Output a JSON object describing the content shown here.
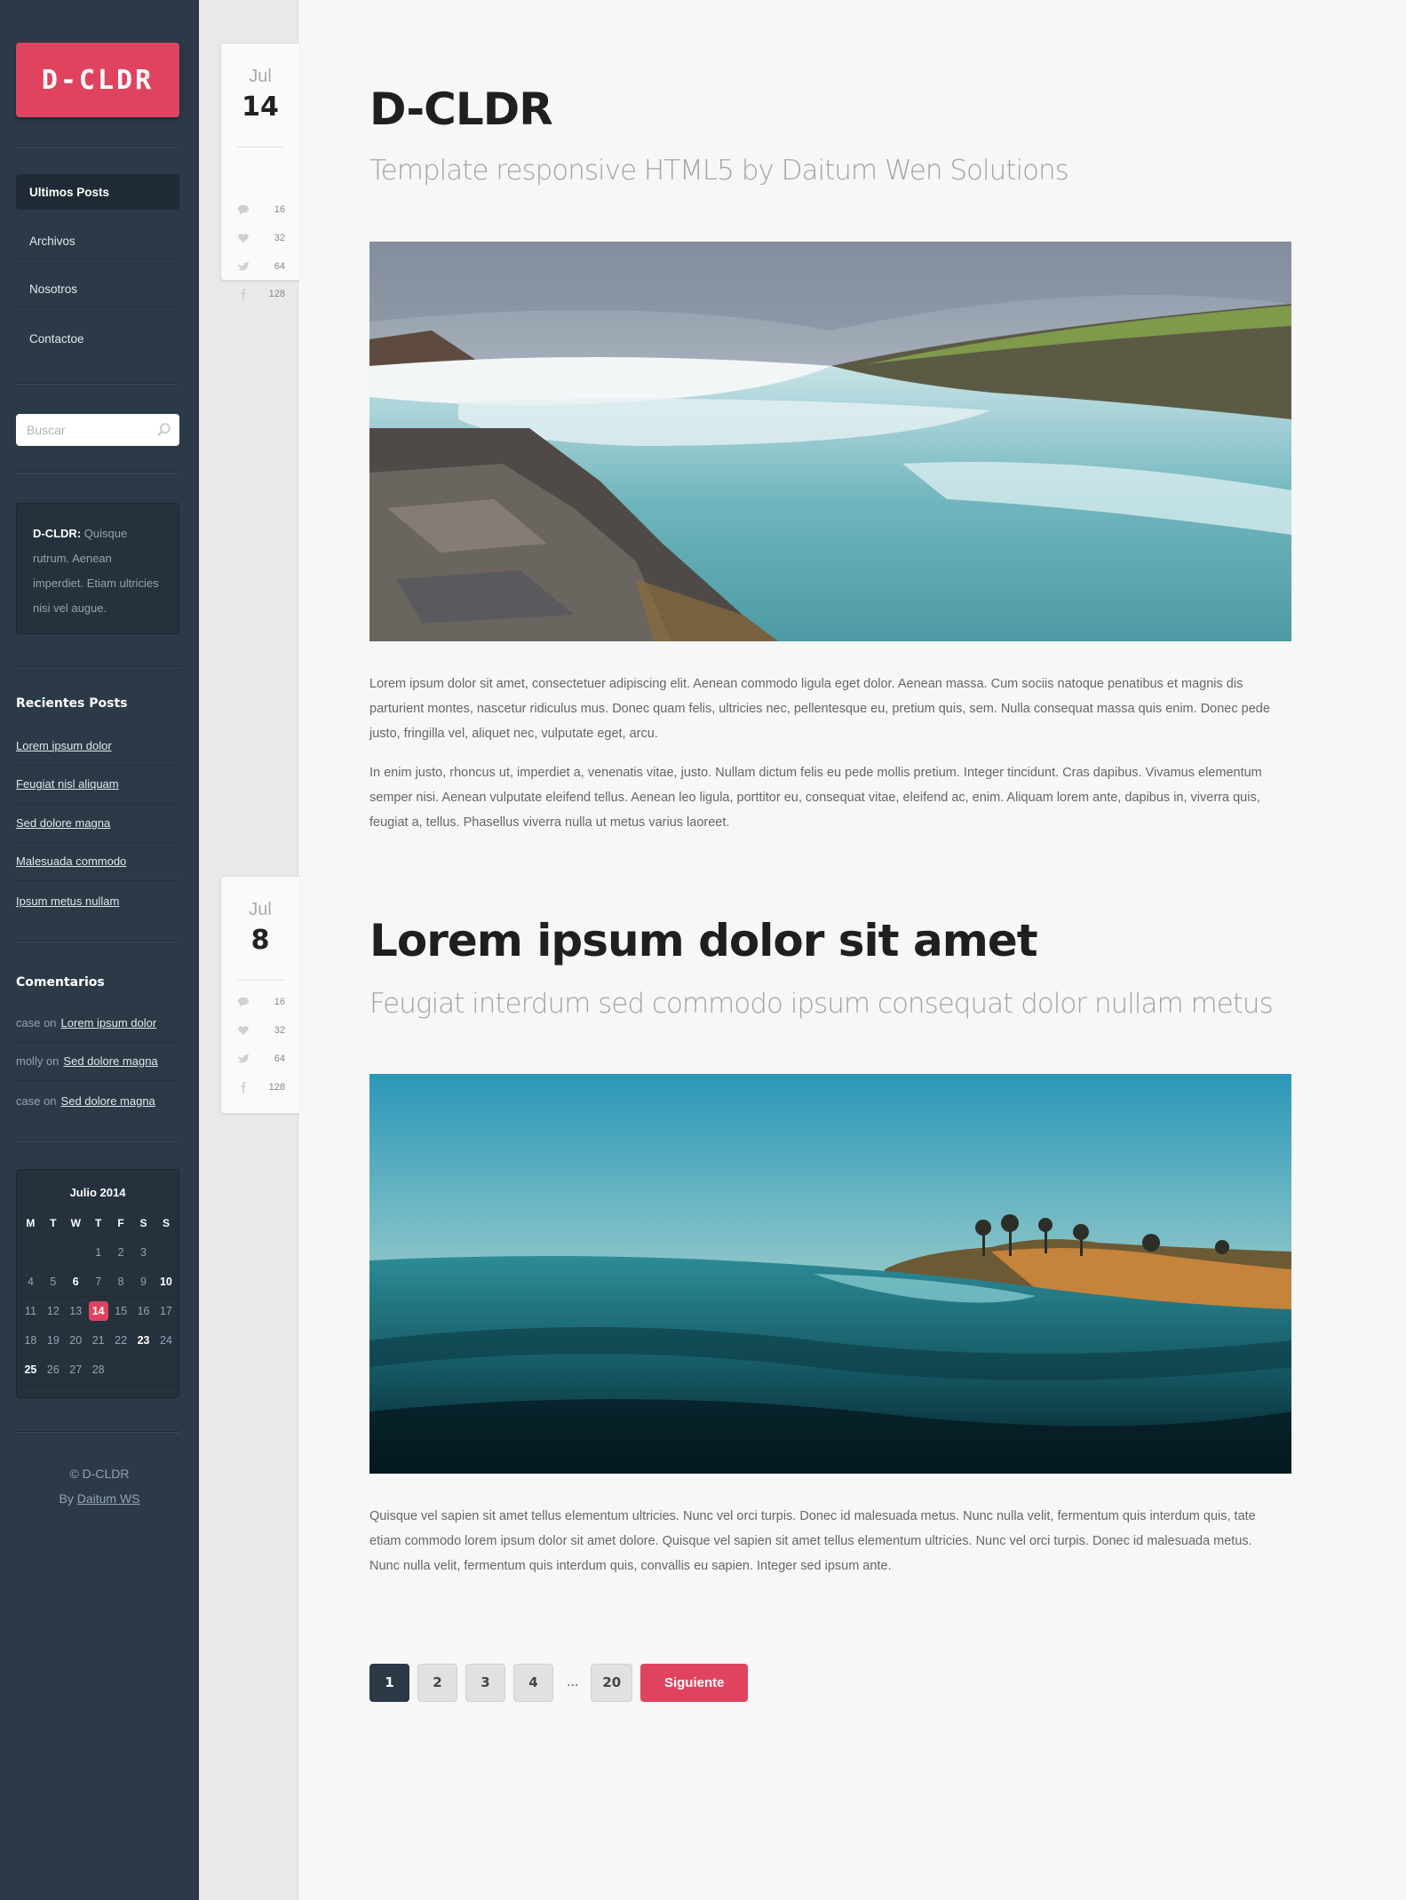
{
  "brand": {
    "logo": "D-CLDR"
  },
  "nav": {
    "items": [
      {
        "label": "Ultimos Posts",
        "active": true
      },
      {
        "label": "Archivos"
      },
      {
        "label": "Nosotros"
      },
      {
        "label": "Contactoe"
      }
    ]
  },
  "search": {
    "placeholder": "Buscar",
    "icon": "search-icon"
  },
  "about": {
    "brand": "D-CLDR:",
    "text": " Quisque rutrum. Aenean imperdiet. Etiam ultricies nisi vel augue."
  },
  "recent_posts": {
    "title": "Recientes Posts",
    "items": [
      "Lorem ipsum dolor",
      "Feugiat nisl aliquam",
      "Sed dolore magna",
      "Malesuada commodo",
      "Ipsum metus nullam"
    ]
  },
  "comments": {
    "title": "Comentarios",
    "items": [
      {
        "who": "case on",
        "link": "Lorem ipsum dolor"
      },
      {
        "who": "molly on",
        "link": "Sed dolore magna"
      },
      {
        "who": "case on",
        "link": "Sed dolore magna"
      }
    ]
  },
  "calendar": {
    "title": "Julio 2014",
    "headers": [
      "M",
      "T",
      "W",
      "T",
      "F",
      "S",
      "S"
    ],
    "weeks": [
      [
        "",
        "",
        "",
        "1",
        "2",
        "3",
        ""
      ],
      [
        "4",
        "5",
        "6",
        "7",
        "8",
        "9",
        "10"
      ],
      [
        "11",
        "12",
        "13",
        "14",
        "15",
        "16",
        "17"
      ],
      [
        "18",
        "19",
        "20",
        "21",
        "22",
        "23",
        "24"
      ],
      [
        "25",
        "26",
        "27",
        "28",
        "",
        "",
        ""
      ]
    ],
    "bold_days": [
      "6",
      "10",
      "23",
      "25"
    ],
    "today": "14"
  },
  "footer": {
    "copyright": "© D-CLDR",
    "by": "By",
    "by_link": "Daitum WS"
  },
  "posts": [
    {
      "month": "Jul",
      "day": "14",
      "stats": {
        "comments": "16",
        "likes": "32",
        "tweets": "64",
        "shares": "128"
      },
      "title": "D-CLDR",
      "subtitle": "Template responsive HTML5 by Daitum Wen Solutions",
      "paragraphs": [
        "Lorem ipsum dolor sit amet, consectetuer adipiscing elit. Aenean commodo ligula eget dolor. Aenean massa. Cum sociis natoque penatibus et magnis dis parturient montes, nascetur ridiculus mus. Donec quam felis, ultricies nec, pellentesque eu, pretium quis, sem. Nulla consequat massa quis enim. Donec pede justo, fringilla vel, aliquet nec, vulputate eget, arcu.",
        "In enim justo, rhoncus ut, imperdiet a, venenatis vitae, justo. Nullam dictum felis eu pede mollis pretium. Integer tincidunt. Cras dapibus. Vivamus elementum semper nisi. Aenean vulputate eleifend tellus. Aenean leo ligula, porttitor eu, consequat vitae, eleifend ac, enim. Aliquam lorem ante, dapibus in, viverra quis, feugiat a, tellus. Phasellus viverra nulla ut metus varius laoreet."
      ]
    },
    {
      "month": "Jul",
      "day": "8",
      "stats": {
        "comments": "16",
        "likes": "32",
        "tweets": "64",
        "shares": "128"
      },
      "title": "Lorem ipsum dolor sit amet",
      "subtitle": "Feugiat interdum sed commodo ipsum consequat dolor nullam metus",
      "paragraphs": [
        "Quisque vel sapien sit amet tellus elementum ultricies. Nunc vel orci turpis. Donec id malesuada metus. Nunc nulla velit, fermentum quis interdum quis, tate etiam commodo lorem ipsum dolor sit amet dolore. Quisque vel sapien sit amet tellus elementum ultricies. Nunc vel orci turpis. Donec id malesuada metus. Nunc nulla velit, fermentum quis interdum quis, convallis eu sapien. Integer sed ipsum ante."
      ]
    }
  ],
  "pagination": {
    "pages": [
      "1",
      "2",
      "3",
      "4"
    ],
    "dots": "...",
    "last": "20",
    "next": "Siguiente",
    "current": "1"
  }
}
